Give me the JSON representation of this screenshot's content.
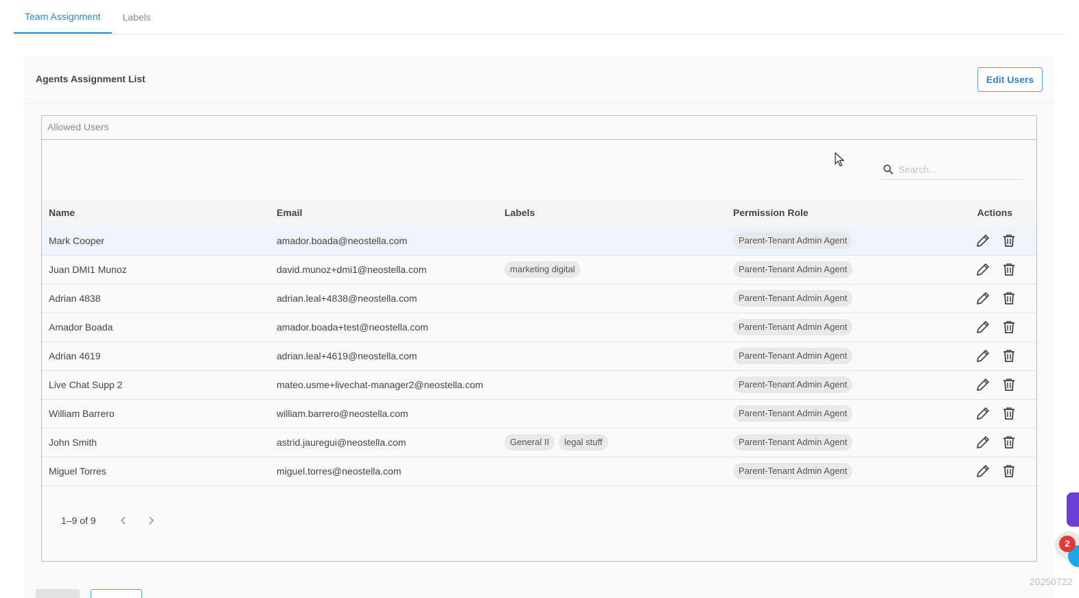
{
  "tabs": [
    {
      "label": "Team Assignment",
      "active": true
    },
    {
      "label": "Labels",
      "active": false
    }
  ],
  "card": {
    "title": "Agents Assignment List",
    "edit_button": "Edit Users"
  },
  "allowed_users": {
    "label": "Allowed Users",
    "search_placeholder": "Search...",
    "columns": [
      "Name",
      "Email",
      "Labels",
      "Permission Role",
      "Actions"
    ],
    "rows": [
      {
        "name": "Mark Cooper",
        "email": "amador.boada@neostella.com",
        "labels": [],
        "role": "Parent-Tenant Admin Agent"
      },
      {
        "name": "Juan DMI1 Munoz",
        "email": "david.munoz+dmi1@neostella.com",
        "labels": [
          "marketing digital"
        ],
        "role": "Parent-Tenant Admin Agent"
      },
      {
        "name": "Adrian 4838",
        "email": "adrian.leal+4838@neostella.com",
        "labels": [],
        "role": "Parent-Tenant Admin Agent"
      },
      {
        "name": "Amador Boada",
        "email": "amador.boada+test@neostella.com",
        "labels": [],
        "role": "Parent-Tenant Admin Agent"
      },
      {
        "name": "Adrian 4619",
        "email": "adrian.leal+4619@neostella.com",
        "labels": [],
        "role": "Parent-Tenant Admin Agent"
      },
      {
        "name": "Live Chat Supp 2",
        "email": "mateo.usme+livechat-manager2@neostella.com",
        "labels": [],
        "role": "Parent-Tenant Admin Agent"
      },
      {
        "name": "William Barrero",
        "email": "william.barrero@neostella.com",
        "labels": [],
        "role": "Parent-Tenant Admin Agent"
      },
      {
        "name": "John Smith",
        "email": "astrid.jauregui@neostella.com",
        "labels": [
          "General II",
          "legal stuff"
        ],
        "role": "Parent-Tenant Admin Agent"
      },
      {
        "name": "Miguel Torres",
        "email": "miguel.torres@neostella.com",
        "labels": [],
        "role": "Parent-Tenant Admin Agent"
      }
    ],
    "pagination": "1–9 of 9"
  },
  "widgets": {
    "notification_count": "2"
  },
  "stamp": "20250722",
  "colors": {
    "accent": "#2f86c8",
    "badge": "#e53935",
    "chat_widget": "#6a3fd6"
  }
}
